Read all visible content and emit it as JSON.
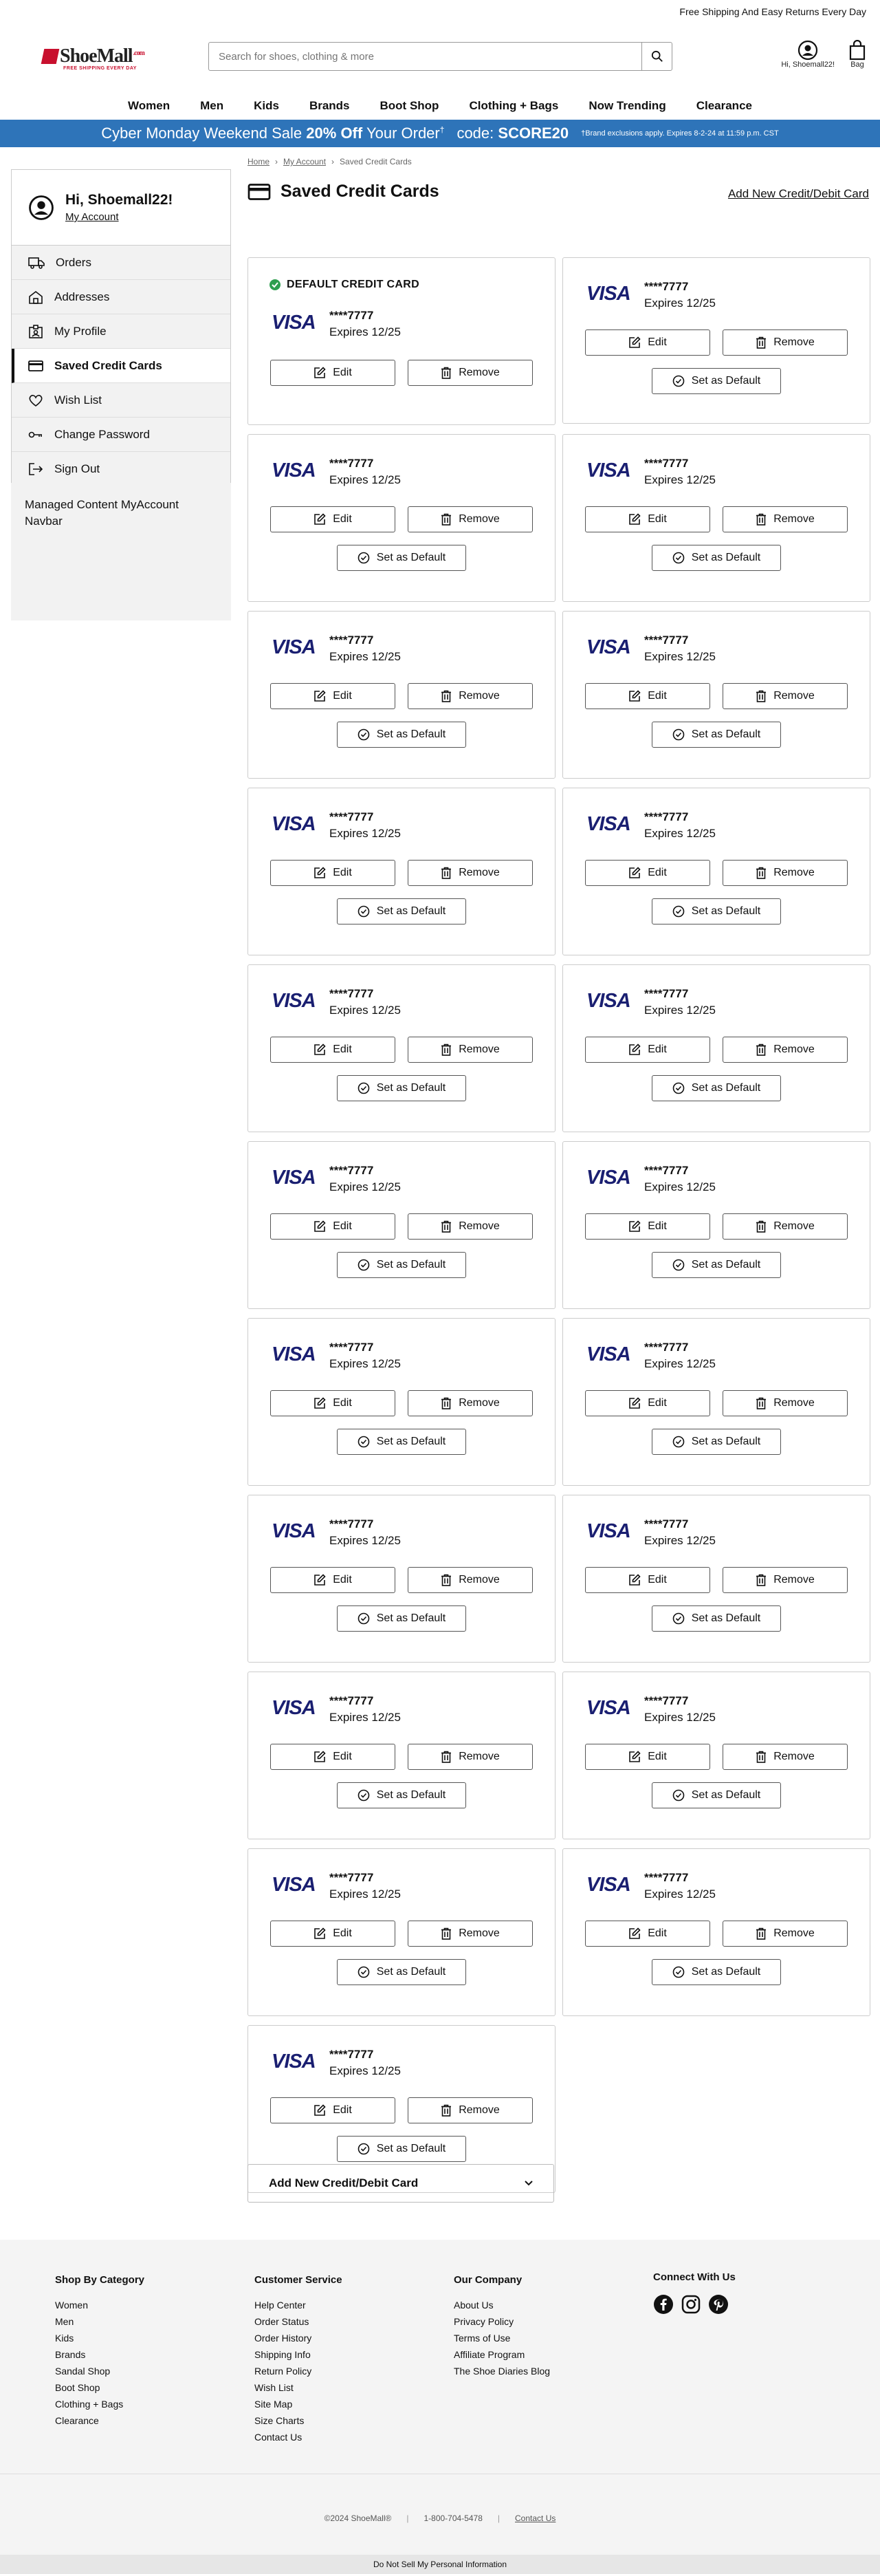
{
  "topbar": {
    "text": "Free Shipping And Easy Returns Every Day"
  },
  "logo": {
    "name": "ShoeMall",
    "suffix": ".com",
    "tagline": "FREE SHIPPING EVERY DAY"
  },
  "search": {
    "placeholder": "Search for shoes, clothing & more"
  },
  "header": {
    "account_label": "Hi, Shoemall22!",
    "bag_label": "Bag"
  },
  "nav": [
    "Women",
    "Men",
    "Kids",
    "Brands",
    "Boot Shop",
    "Clothing + Bags",
    "Now Trending",
    "Clearance"
  ],
  "promo": {
    "lead": "Cyber Monday Weekend Sale",
    "pct": "20% Off",
    "tail": "Your Order",
    "sup": "†",
    "code_label": "code:",
    "code": "SCORE20",
    "fine": "†Brand exclusions apply. Expires 8-2-24 at 11:59 p.m. CST"
  },
  "sidebar": {
    "greeting": "Hi, Shoemall22!",
    "account_link": "My Account",
    "items": [
      {
        "label": "Orders",
        "icon": "truck-icon"
      },
      {
        "label": "Addresses",
        "icon": "home-icon"
      },
      {
        "label": "My Profile",
        "icon": "profile-icon"
      },
      {
        "label": "Saved Credit Cards",
        "icon": "credit-card-icon",
        "active": true
      },
      {
        "label": "Wish List",
        "icon": "heart-icon"
      },
      {
        "label": "Change Password",
        "icon": "key-icon"
      },
      {
        "label": "Sign Out",
        "icon": "sign-out-icon"
      }
    ],
    "managed": "Managed Content MyAccount Navbar"
  },
  "breadcrumb": [
    "Home",
    "My Account",
    "Saved Credit Cards"
  ],
  "page": {
    "title": "Saved Credit Cards",
    "add_link": "Add New Credit/Debit Card"
  },
  "cards": {
    "default_label": "DEFAULT CREDIT CARD",
    "brand": "VISA",
    "number": "****7777",
    "expires": "Expires 12/25",
    "edit": "Edit",
    "remove": "Remove",
    "set_default": "Set as Default",
    "count": 21
  },
  "add_new": {
    "label": "Add New Credit/Debit Card"
  },
  "footer": {
    "cols": [
      {
        "title": "Shop By Category",
        "items": [
          "Women",
          "Men",
          "Kids",
          "Brands",
          "Sandal Shop",
          "Boot Shop",
          "Clothing + Bags",
          "Clearance"
        ]
      },
      {
        "title": "Customer Service",
        "items": [
          "Help Center",
          "Order Status",
          "Order History",
          "Shipping Info",
          "Return Policy",
          "Wish List",
          "Site Map",
          "Size Charts",
          "Contact Us"
        ]
      },
      {
        "title": "Our Company",
        "items": [
          "About Us",
          "Privacy Policy",
          "Terms of Use",
          "Affiliate Program",
          "The Shoe Diaries Blog"
        ]
      },
      {
        "title": "Connect With Us",
        "items": []
      }
    ],
    "copyright": "©2024 ShoeMall®",
    "phone": "1-800-704-5478",
    "contact": "Contact Us",
    "dns": "Do Not Sell My Personal Information"
  },
  "colors": {
    "promo": "#2e74b9",
    "visa": "#1a1f71",
    "check": "#2e9e4f",
    "brand": "#c8102e"
  }
}
